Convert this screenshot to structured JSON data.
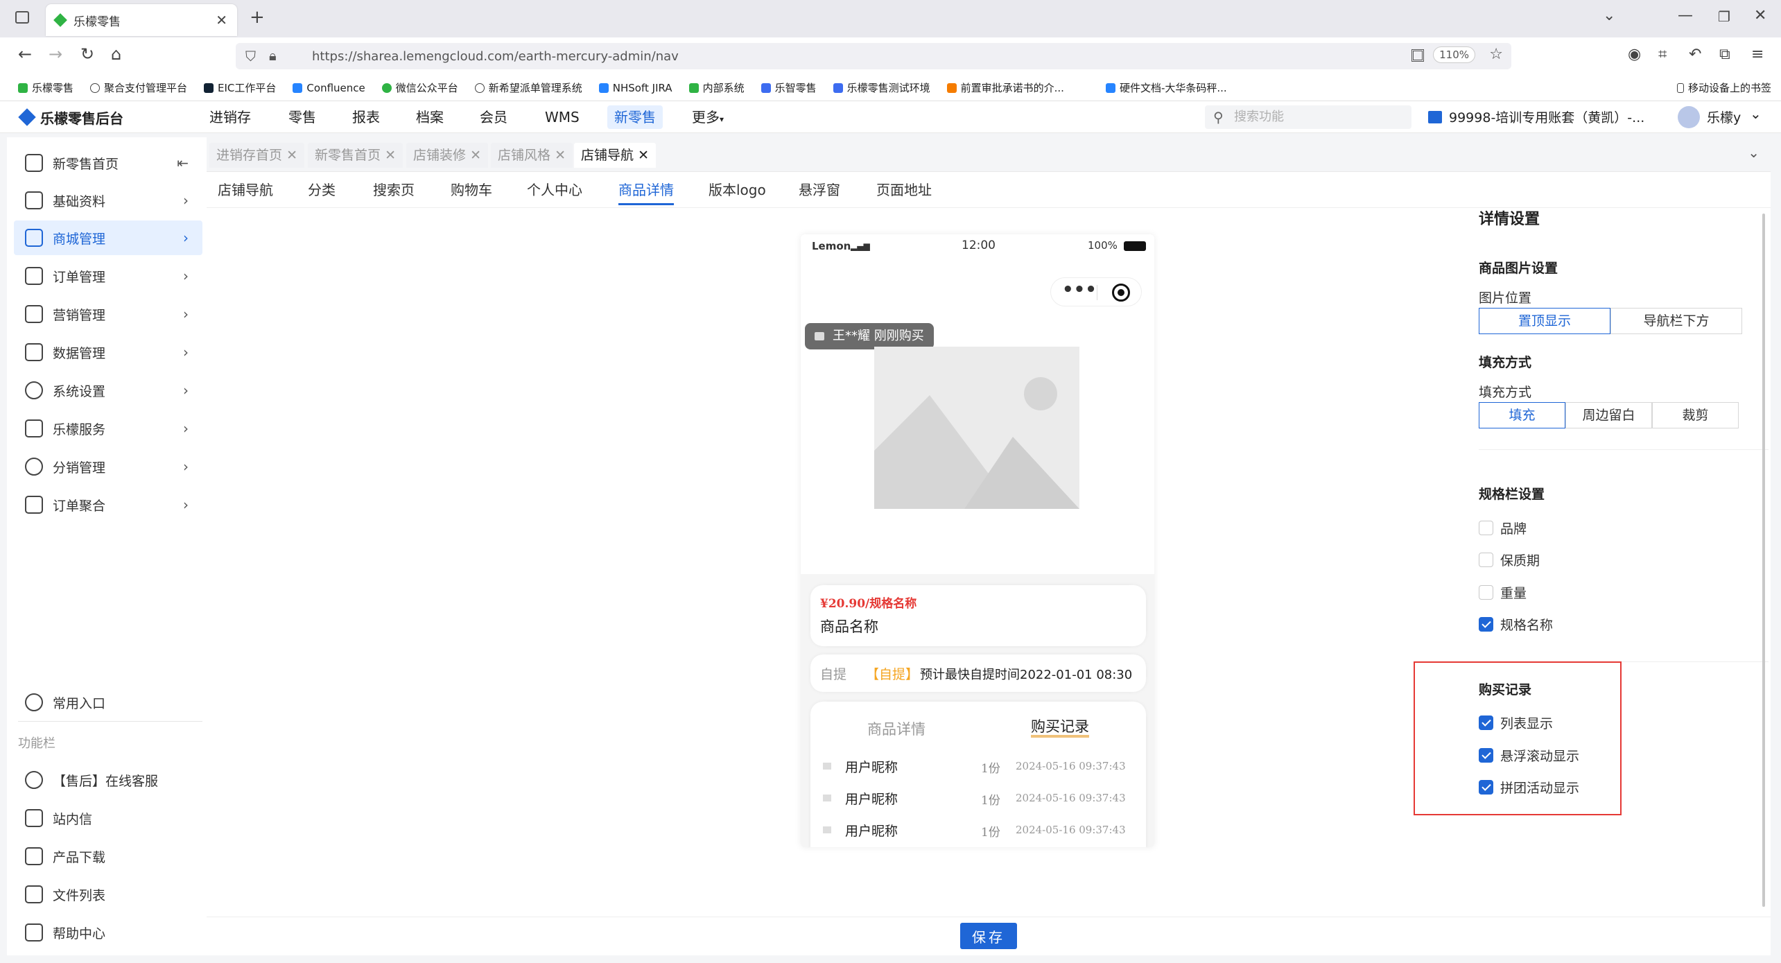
{
  "browser": {
    "tab_title": "乐檬零售",
    "url": "https://sharea.lemengcloud.com/earth-mercury-admin/nav",
    "zoom": "110%",
    "bookmarks": [
      "乐檬零售",
      "聚合支付管理平台",
      "EIC工作平台",
      "Confluence",
      "微信公众平台",
      "新希望派单管理系统",
      "NHSoft JIRA",
      "内部系统",
      "乐智零售",
      "乐檬零售测试环境",
      "前置审批承诺书的介...",
      "硬件文档-大华条码秤..."
    ],
    "mobile_bookmarks": "移动设备上的书签"
  },
  "app": {
    "logo": "乐檬零售后台",
    "nav": [
      "进销存",
      "零售",
      "报表",
      "档案",
      "会员",
      "WMS",
      "新零售",
      "更多"
    ],
    "search_placeholder": "搜索功能",
    "account": "99998-培训专用账套（黄凯）-...",
    "user": "乐檬y"
  },
  "sidebar": {
    "items": [
      "新零售首页",
      "基础资料",
      "商城管理",
      "订单管理",
      "营销管理",
      "数据管理",
      "系统设置",
      "乐檬服务",
      "分销管理",
      "订单聚合"
    ],
    "common": "常用入口",
    "section": "功能栏",
    "tools": [
      "【售后】在线客服",
      "站内信",
      "产品下载",
      "文件列表",
      "帮助中心"
    ]
  },
  "page_tabs": [
    "进销存首页",
    "新零售首页",
    "店铺装修",
    "店铺风格",
    "店铺导航"
  ],
  "sub_tabs": [
    "店铺导航",
    "分类",
    "搜索页",
    "购物车",
    "个人中心",
    "商品详情",
    "版本logo",
    "悬浮窗",
    "页面地址"
  ],
  "phone": {
    "carrier": "Lemon",
    "time": "12:00",
    "battery": "100%",
    "toast": "王**耀 刚刚购买",
    "price": "¥20.90/",
    "spec": "规格名称",
    "product_name": "商品名称",
    "pickup_label": "自提",
    "pickup_tag": "【自提】",
    "pickup_text": "预计最快自提时间2022-01-01 08:30",
    "tab_detail": "商品详情",
    "tab_record": "购买记录",
    "records": [
      {
        "name": "用户昵称",
        "qty": "1份",
        "time": "2024-05-16 09:37:43"
      },
      {
        "name": "用户昵称",
        "qty": "1份",
        "time": "2024-05-16 09:37:43"
      },
      {
        "name": "用户昵称",
        "qty": "1份",
        "time": "2024-05-16 09:37:43"
      }
    ]
  },
  "settings": {
    "title": "详情设置",
    "image_section": "商品图片设置",
    "image_position_label": "图片位置",
    "image_position_options": [
      "置顶显示",
      "导航栏下方"
    ],
    "fill_section": "填充方式",
    "fill_label": "填充方式",
    "fill_options": [
      "填充",
      "周边留白",
      "裁剪"
    ],
    "spec_section": "规格栏设置",
    "spec_options": [
      {
        "label": "品牌",
        "checked": false
      },
      {
        "label": "保质期",
        "checked": false
      },
      {
        "label": "重量",
        "checked": false
      },
      {
        "label": "规格名称",
        "checked": true
      }
    ],
    "purchase_section": "购买记录",
    "purchase_options": [
      {
        "label": "列表显示",
        "checked": true
      },
      {
        "label": "悬浮滚动显示",
        "checked": true
      },
      {
        "label": "拼团活动显示",
        "checked": true
      }
    ]
  },
  "save_label": "保存",
  "colors": {
    "accent": "#1f66d6",
    "highlight_border": "#e53935",
    "price": "#e53935",
    "pickup_tag": "#f5a623"
  }
}
